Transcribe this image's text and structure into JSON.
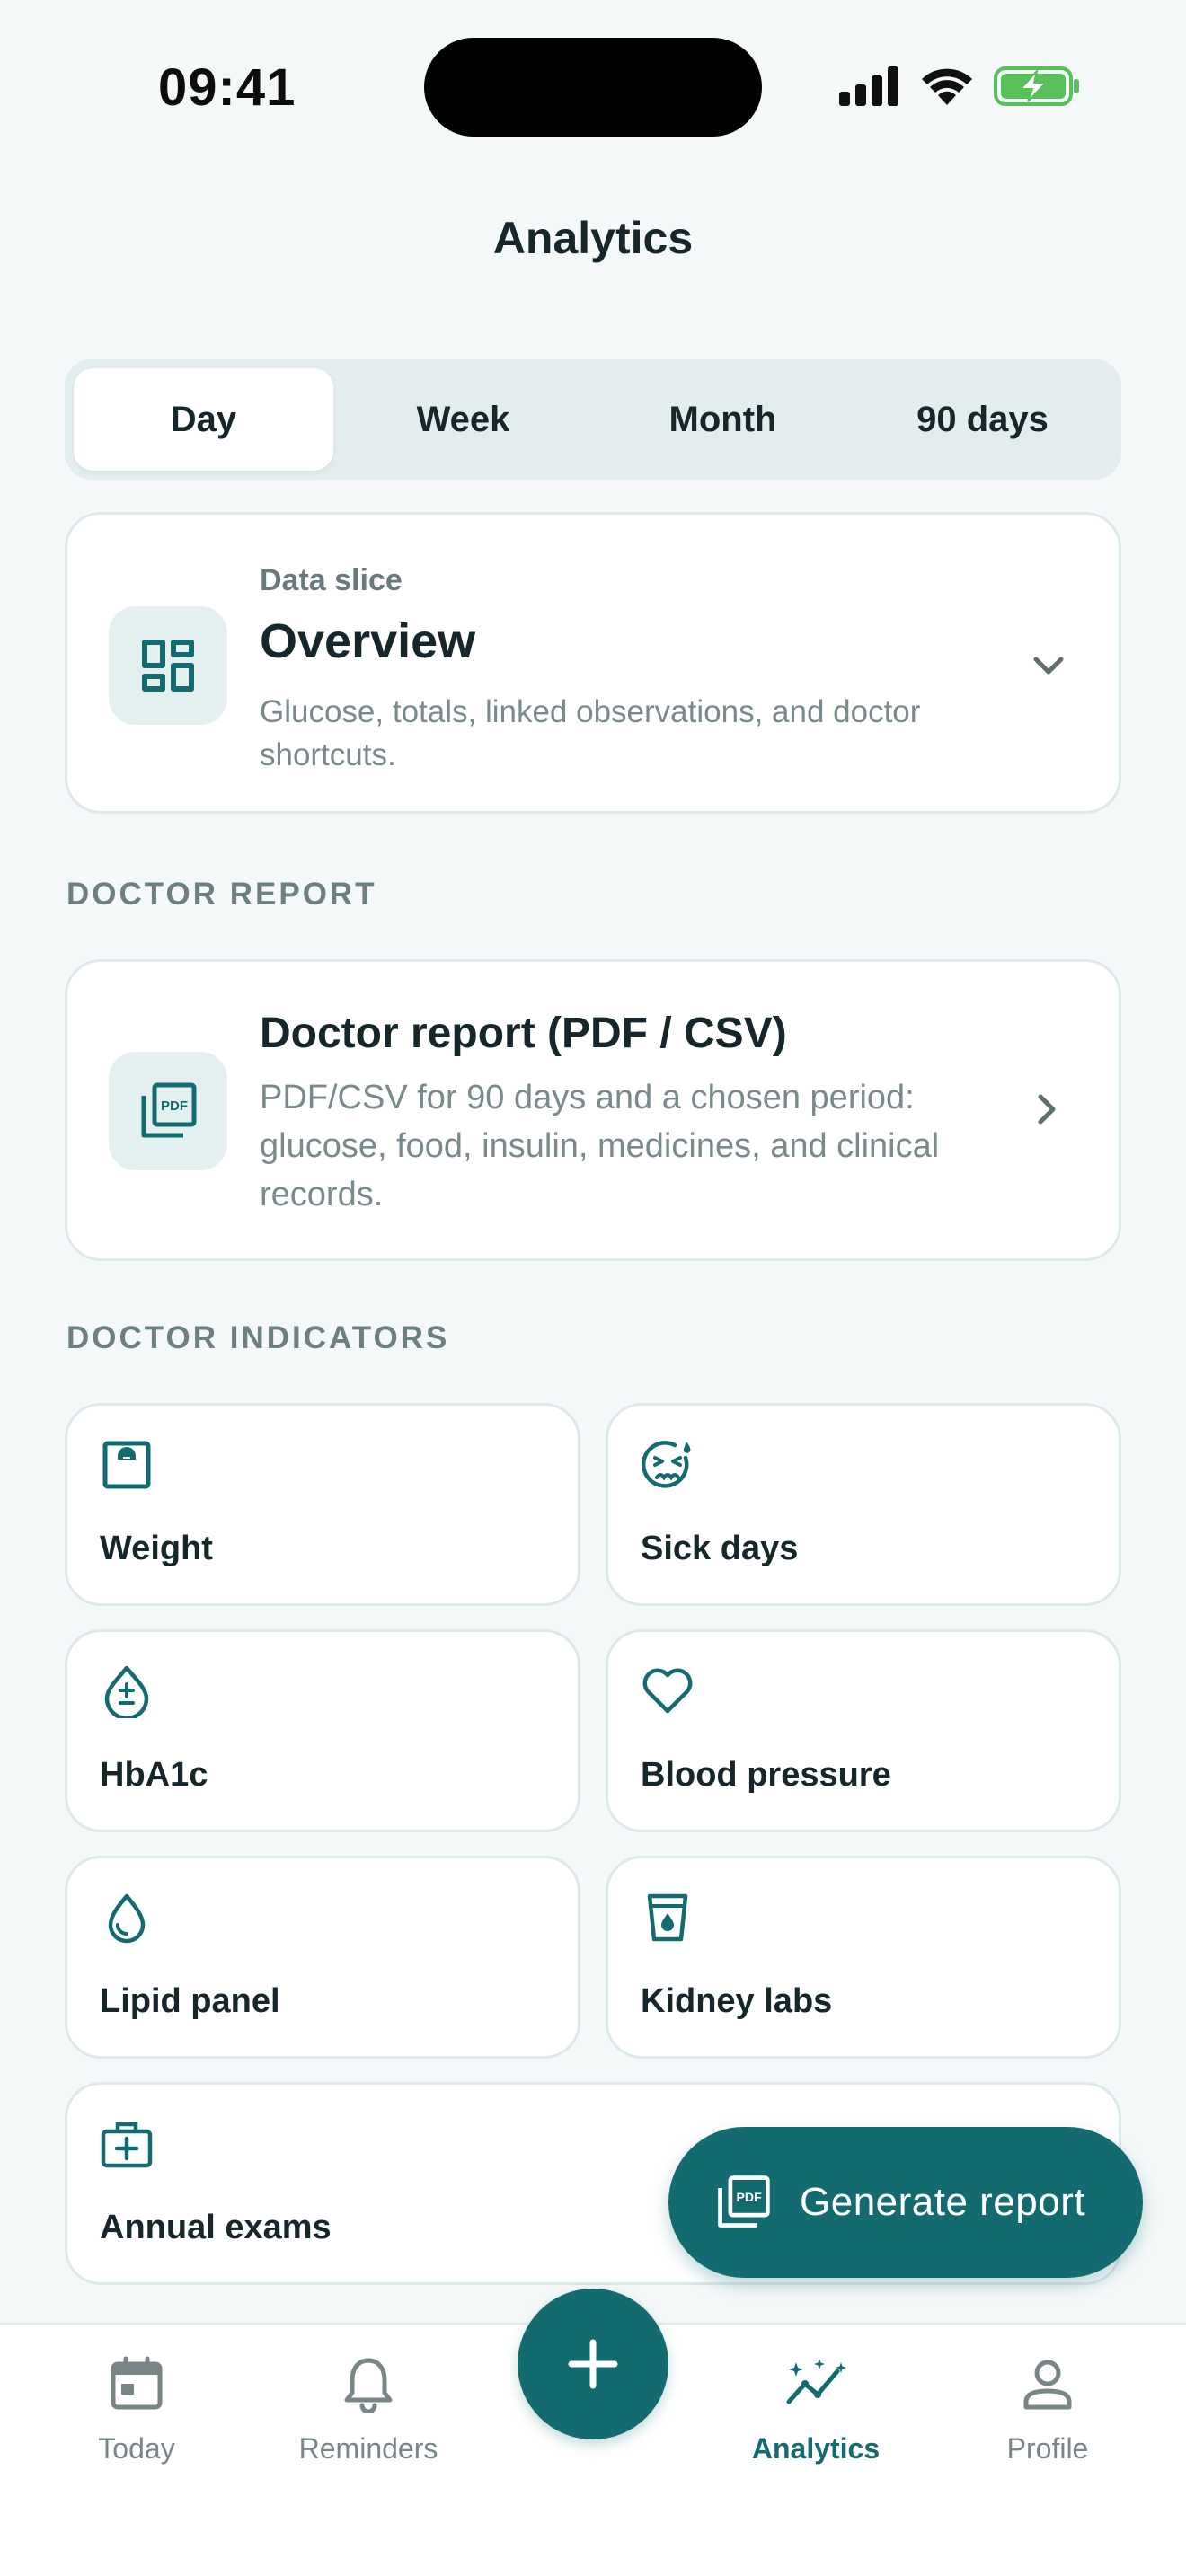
{
  "status_bar": {
    "time": "09:41"
  },
  "header": {
    "title": "Analytics"
  },
  "period_tabs": [
    {
      "label": "Day",
      "active": true
    },
    {
      "label": "Week",
      "active": false
    },
    {
      "label": "Month",
      "active": false
    },
    {
      "label": "90 days",
      "active": false
    }
  ],
  "data_slice": {
    "label": "Data slice",
    "title": "Overview",
    "description": "Glucose, totals, linked observations, and doctor shortcuts.",
    "icon": "dashboard-icon"
  },
  "doctor_report_section": {
    "heading": "DOCTOR REPORT",
    "card": {
      "title": "Doctor report (PDF / CSV)",
      "description": "PDF/CSV for 90 days and a chosen period: glucose, food, insulin, medicines, and clinical records.",
      "icon": "pdf-icon"
    }
  },
  "doctor_indicators": {
    "heading": "DOCTOR INDICATORS",
    "items": [
      {
        "label": "Weight",
        "icon": "scale-icon"
      },
      {
        "label": "Sick days",
        "icon": "sick-face-icon"
      },
      {
        "label": "HbA1c",
        "icon": "blood-drop-icon"
      },
      {
        "label": "Blood pressure",
        "icon": "heart-icon"
      },
      {
        "label": "Lipid panel",
        "icon": "drop-icon"
      },
      {
        "label": "Kidney labs",
        "icon": "cup-icon"
      },
      {
        "label": "Annual exams",
        "icon": "medical-kit-icon"
      }
    ]
  },
  "generate_button": {
    "label": "Generate report",
    "icon": "pdf-icon"
  },
  "tab_bar": {
    "items": [
      {
        "label": "Today",
        "icon": "calendar-icon",
        "active": false
      },
      {
        "label": "Reminders",
        "icon": "bell-icon",
        "active": false
      },
      {
        "label": "Analytics",
        "icon": "analytics-icon",
        "active": true
      },
      {
        "label": "Profile",
        "icon": "person-icon",
        "active": false
      }
    ],
    "add_icon": "plus-icon"
  },
  "colors": {
    "accent": "#136b70",
    "background": "#f4f8f8",
    "tile_bg": "#e4f0f0"
  }
}
